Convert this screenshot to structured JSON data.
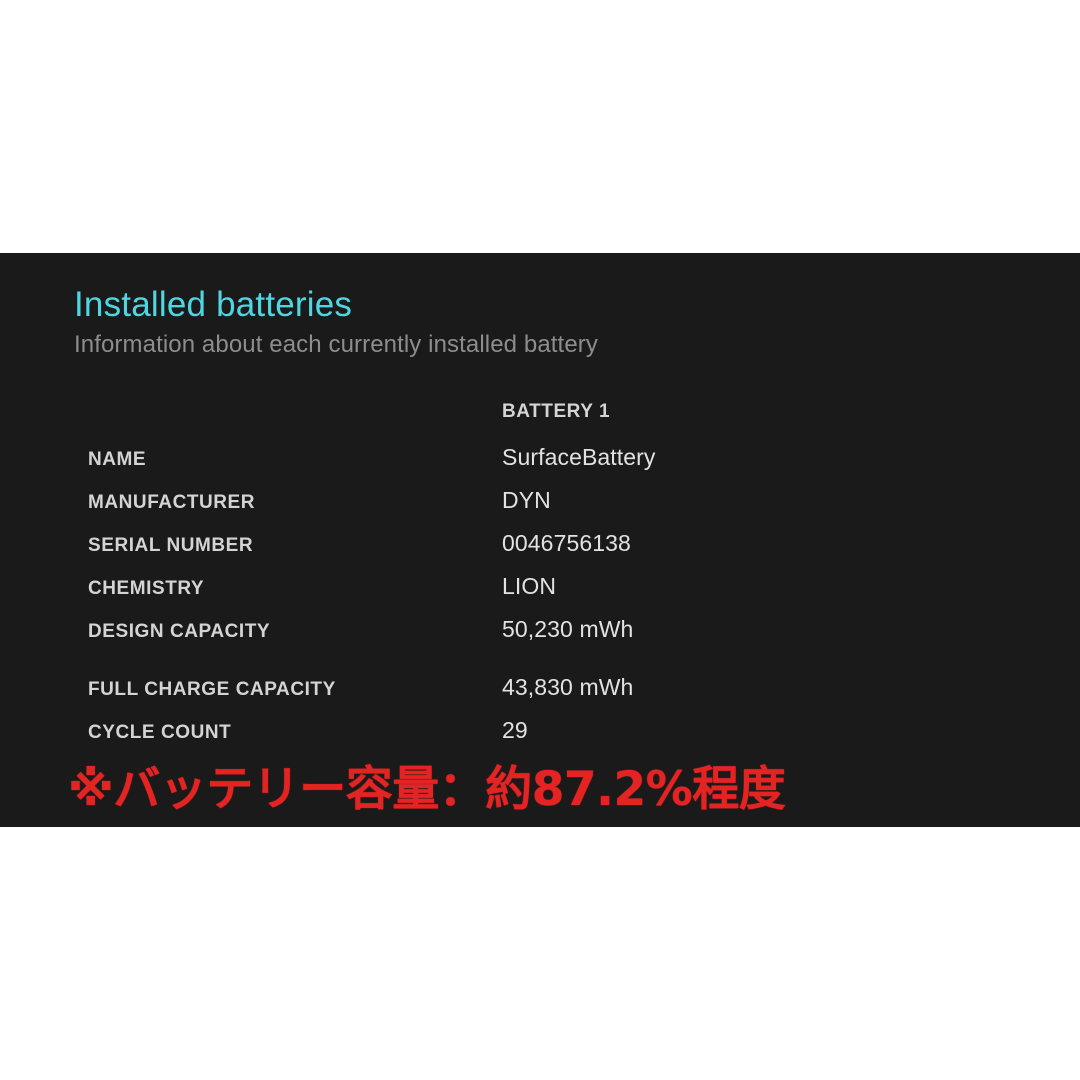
{
  "panel": {
    "background_color": "#1a1a1a",
    "page_background_color": "#ffffff",
    "accent_color": "#4fd6e2",
    "annotation_color": "#e42423"
  },
  "header": {
    "title": "Installed batteries",
    "subtitle": "Information about each currently installed battery"
  },
  "table": {
    "column_header": "BATTERY 1",
    "rows": [
      {
        "label": "NAME",
        "value": "SurfaceBattery"
      },
      {
        "label": "MANUFACTURER",
        "value": "DYN"
      },
      {
        "label": "SERIAL NUMBER",
        "value": "0046756138"
      },
      {
        "label": "CHEMISTRY",
        "value": "LION"
      },
      {
        "label": "DESIGN CAPACITY",
        "value": "50,230 mWh"
      },
      {
        "label": "FULL CHARGE CAPACITY",
        "value": "43,830 mWh"
      },
      {
        "label": "CYCLE COUNT",
        "value": "29"
      }
    ]
  },
  "annotation": {
    "text": "※バッテリー容量：約87.2%程度"
  }
}
